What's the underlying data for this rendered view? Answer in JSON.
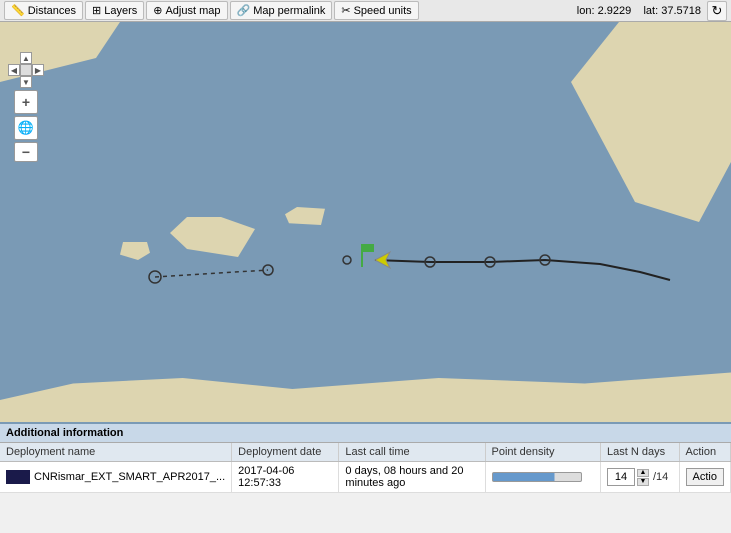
{
  "toolbar": {
    "distances_label": "Distances",
    "layers_label": "Layers",
    "adjust_map_label": "Adjust map",
    "permalink_label": "Map permalink",
    "speed_units_label": "Speed units",
    "lon_label": "lon:",
    "lon_value": "2.9229",
    "lat_label": "lat:",
    "lat_value": "37.5718"
  },
  "nav": {
    "up": "▲",
    "down": "▼",
    "left": "◀",
    "right": "▶",
    "plus": "+",
    "minus": "−",
    "globe": "🌐"
  },
  "info_panel": {
    "header": "Additional information",
    "columns": [
      "Deployment name",
      "Deployment date",
      "Last call time",
      "Point density",
      "Last N days",
      "Action"
    ],
    "row": {
      "color": "#1a1a4a",
      "name": "CNRismar_EXT_SMART_APR2017_...",
      "date": "2017-04-06 12:57:33",
      "last_call": "0 days, 08 hours and 20 minutes ago",
      "days_value": "14",
      "days_total": "/14",
      "action_label": "Actio"
    }
  }
}
